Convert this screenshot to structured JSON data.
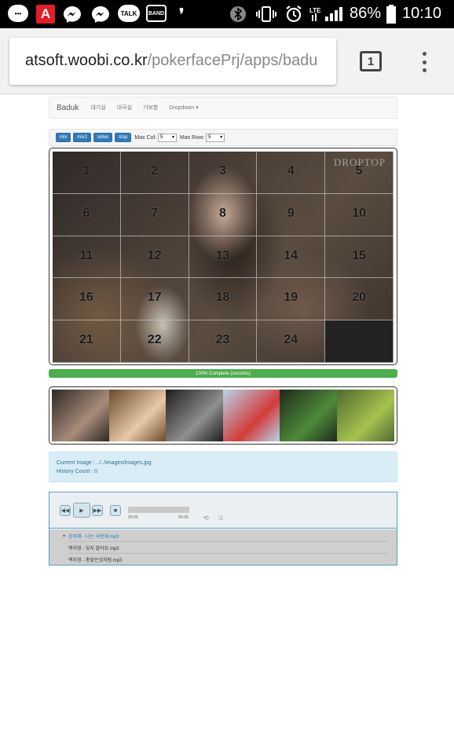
{
  "status_bar": {
    "left_icons": [
      "chat-icon",
      "acrobat-icon",
      "messenger-icon",
      "messenger-icon",
      "kakaotalk-icon",
      "band-icon",
      "notification-icon"
    ],
    "talk_label": "TALK",
    "band_label": "BAND",
    "a_label": "A",
    "battery_percent": "86%",
    "time": "10:10",
    "network": "LTE"
  },
  "browser": {
    "url_host": "atsoft.woobi.co.kr",
    "url_path": "/pokerfacePrj/apps/badu",
    "tab_count": "1"
  },
  "navbar": {
    "brand": "Baduk",
    "links": [
      "대기실",
      "대국실",
      "기보함",
      "Dropdown ▾"
    ]
  },
  "toolbar": {
    "buttons": [
      "mix",
      "mix2",
      "solve",
      "stop"
    ],
    "max_col_label": "Max Col:",
    "max_col_value": "5",
    "max_row_label": "Max Row:",
    "max_row_value": "5"
  },
  "puzzle": {
    "tiles": [
      "1",
      "2",
      "3",
      "4",
      "5",
      "6",
      "7",
      "8",
      "9",
      "10",
      "11",
      "12",
      "13",
      "14",
      "15",
      "16",
      "17",
      "18",
      "19",
      "20",
      "21",
      "22",
      "23",
      "24",
      ""
    ],
    "watermark": "DROPTOP"
  },
  "progress": {
    "value": 1.0,
    "label": "100% Complete (success)",
    "color": "#5cb85c"
  },
  "thumbnails": [
    {
      "name": "thumb-1",
      "colors": [
        "#2e2723",
        "#a88c7a"
      ]
    },
    {
      "name": "thumb-2",
      "colors": [
        "#6a4a2a",
        "#e8c9a8"
      ]
    },
    {
      "name": "thumb-3",
      "colors": [
        "#1d1d1d",
        "#8f8f8f"
      ]
    },
    {
      "name": "thumb-4",
      "colors": [
        "#b7d4ea",
        "#d33a3a"
      ]
    },
    {
      "name": "thumb-5",
      "colors": [
        "#1e2a1c",
        "#4e8a3a"
      ]
    },
    {
      "name": "thumb-6",
      "colors": [
        "#4e6a2e",
        "#a7c24f"
      ]
    }
  ],
  "info": {
    "current_image": "Current Image : ../../images/images.jpg",
    "history_count": "History Count : 0"
  },
  "player": {
    "time_current": "00:00",
    "time_total": "04:00",
    "playlist": [
      {
        "title": "윤미래 - 너는 사랑해.mp3",
        "active": true
      },
      {
        "title": "백지영 - 잊지 말아요.mp3",
        "active": false
      },
      {
        "title": "백지영 - 총맞은것처럼.mp3",
        "active": false
      }
    ]
  }
}
